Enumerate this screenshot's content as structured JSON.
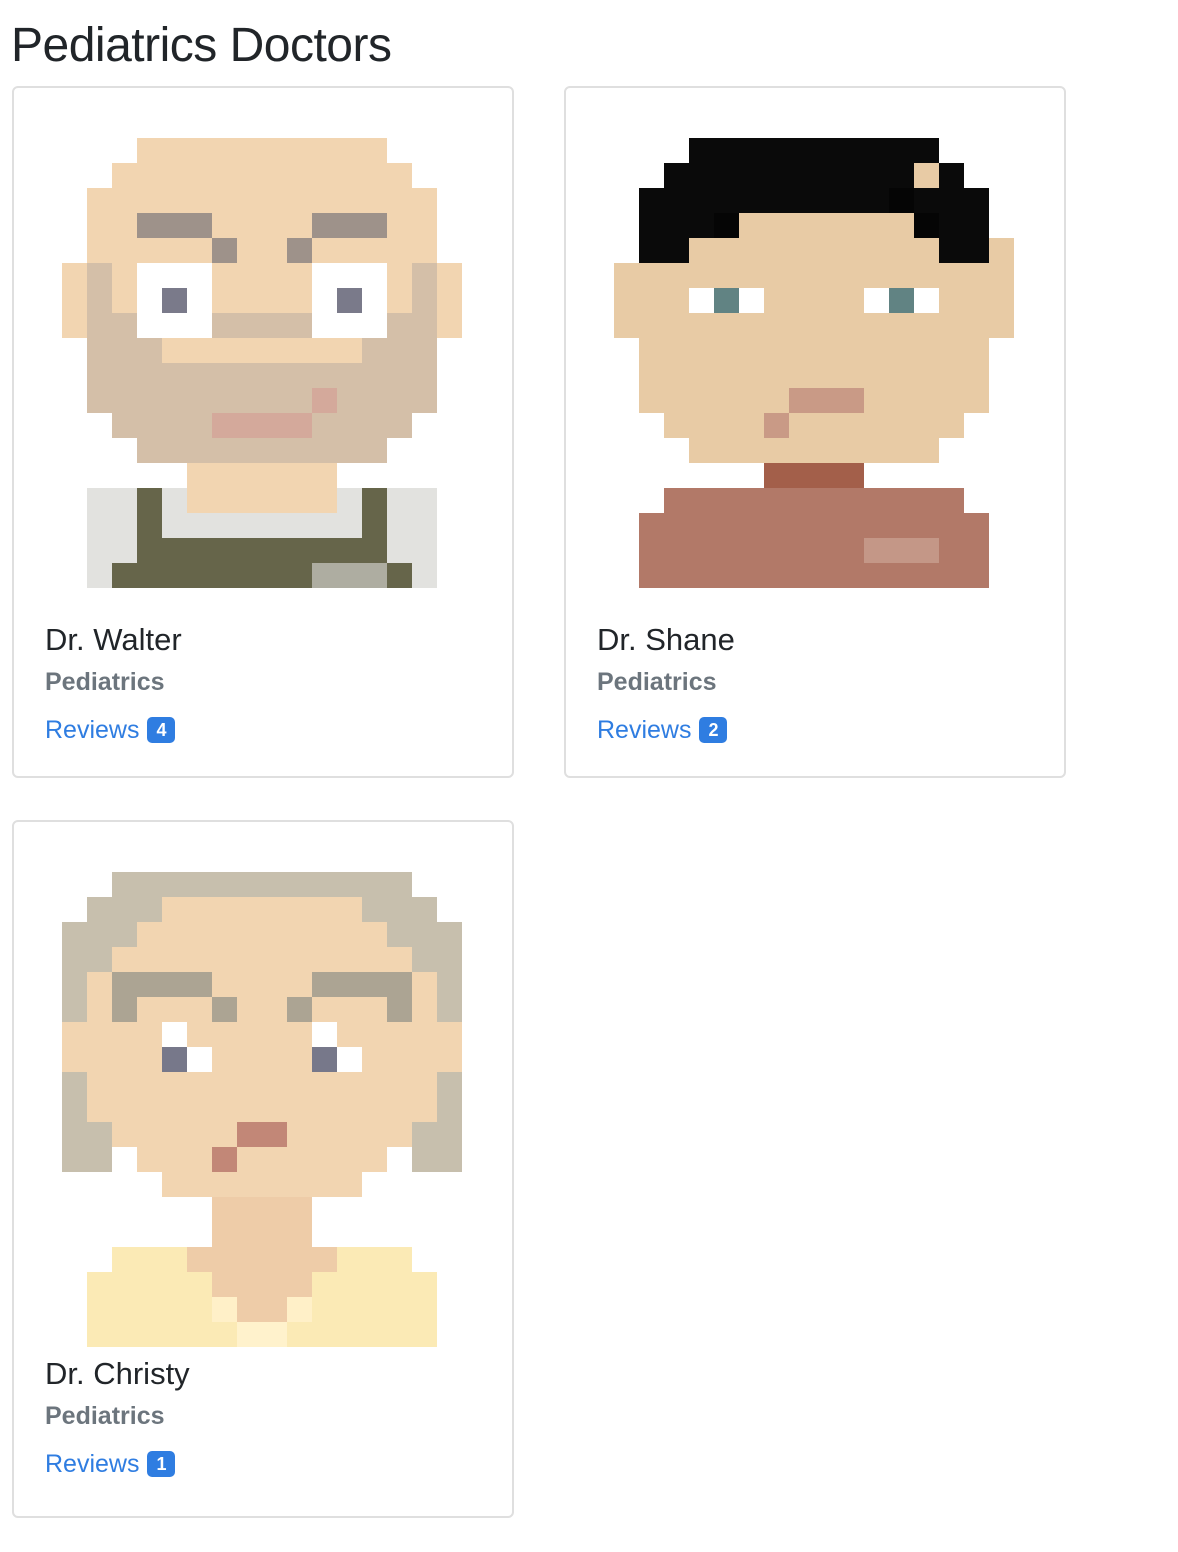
{
  "page": {
    "title": "Pediatrics Doctors"
  },
  "doctors": [
    {
      "name": "Dr. Walter",
      "specialty": "Pediatrics",
      "reviews_label": "Reviews",
      "reviews_count": "4",
      "avatar": "walter-avatar"
    },
    {
      "name": "Dr. Shane",
      "specialty": "Pediatrics",
      "reviews_label": "Reviews",
      "reviews_count": "2",
      "avatar": "shane-avatar"
    },
    {
      "name": "Dr. Christy",
      "specialty": "Pediatrics",
      "reviews_label": "Reviews",
      "reviews_count": "1",
      "avatar": "christy-avatar"
    }
  ],
  "colors": {
    "link": "#2f7de1",
    "muted": "#6c757d",
    "border": "#dfdfdf"
  }
}
